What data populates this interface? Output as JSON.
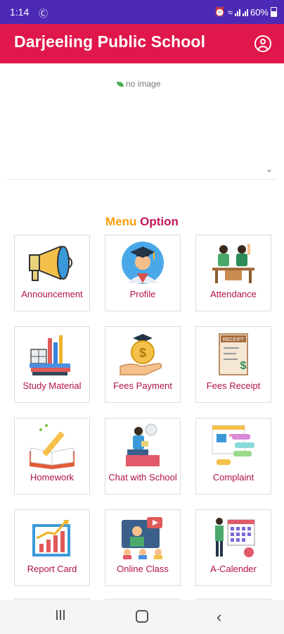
{
  "status": {
    "time": "1:14",
    "battery": "60%"
  },
  "header": {
    "title": "Darjeeling Public School"
  },
  "banner": {
    "alt_text": "no image"
  },
  "menu": {
    "title_part1": "Menu",
    "title_part2": "Option",
    "items": [
      {
        "label": "Announcement",
        "icon": "megaphone-icon"
      },
      {
        "label": "Profile",
        "icon": "graduate-profile-icon"
      },
      {
        "label": "Attendance",
        "icon": "attendance-students-icon"
      },
      {
        "label": "Study Material",
        "icon": "books-stationery-icon"
      },
      {
        "label": "Fees Payment",
        "icon": "coin-hand-icon"
      },
      {
        "label": "Fees Receipt",
        "icon": "receipt-icon"
      },
      {
        "label": "Homework",
        "icon": "notebook-pencil-icon"
      },
      {
        "label": "Chat with School",
        "icon": "chat-person-icon"
      },
      {
        "label": "Complaint",
        "icon": "complaint-messages-icon"
      },
      {
        "label": "Report Card",
        "icon": "report-chart-icon"
      },
      {
        "label": "Online Class",
        "icon": "video-class-icon"
      },
      {
        "label": "A-Calender",
        "icon": "calendar-person-icon"
      }
    ]
  },
  "colors": {
    "status_bar": "#4d2ab5",
    "app_bar": "#e0174b",
    "label": "#b1124a",
    "menu_word": "#f59e0b"
  }
}
